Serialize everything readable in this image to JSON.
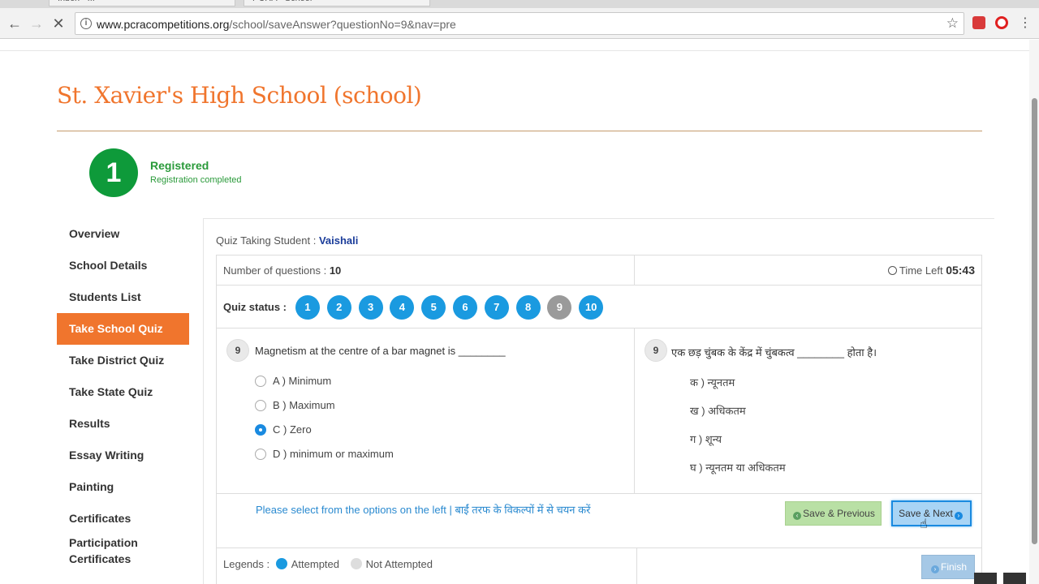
{
  "browser": {
    "tabs": [
      "Inbox - ...",
      "PCRA - School"
    ],
    "url_host": "www.pcracompetitions.org",
    "url_path": "/school/saveAnswer?questionNo=9&nav=pre"
  },
  "page": {
    "school_title": "St. Xavier's High School (school)",
    "step": {
      "number": "1",
      "title": "Registered",
      "subtitle": "Registration completed"
    }
  },
  "sidebar": {
    "items": [
      {
        "label": "Overview"
      },
      {
        "label": "School Details"
      },
      {
        "label": "Students List"
      },
      {
        "label": "Take School Quiz"
      },
      {
        "label": "Take District Quiz"
      },
      {
        "label": "Take State Quiz"
      },
      {
        "label": "Results"
      },
      {
        "label": "Essay Writing"
      },
      {
        "label": "Painting"
      },
      {
        "label": "Certificates"
      },
      {
        "label": "Participation Certificates"
      }
    ]
  },
  "quiz": {
    "student_label": "Quiz Taking Student :",
    "student_name": "Vaishali",
    "num_questions_label": "Number of questions :",
    "num_questions": "10",
    "time_left_label": "Time Left",
    "time_left": "05:43",
    "status_label": "Quiz status :",
    "question_numbers": [
      "1",
      "2",
      "3",
      "4",
      "5",
      "6",
      "7",
      "8",
      "9",
      "10"
    ],
    "current_question": "9",
    "question_en": "Magnetism at the centre of a bar magnet is ________",
    "options_en": [
      "A ) Minimum",
      "B ) Maximum",
      "C ) Zero",
      "D ) minimum or maximum"
    ],
    "selected_option": "C ) Zero",
    "question_hi": "एक छड़ चुंबक के केंद्र में चुंबकत्व ________ होता है।",
    "options_hi": [
      "क ) न्यूनतम",
      "ख ) अधिकतम",
      "ग ) शून्य",
      "घ ) न्यूनतम या अधिकतम"
    ],
    "note": "Please select from the options on the left | बाईं तरफ के विकल्पों में से चयन करें",
    "save_prev_label": "Save & Previous",
    "save_next_label": "Save & Next",
    "legends_label": "Legends :",
    "legend_attempted": "Attempted",
    "legend_not_attempted": "Not Attempted",
    "finish_label": "Finish"
  },
  "colors": {
    "brand_orange": "#f0752d",
    "attempted_blue": "#1a9ae0",
    "current_gray": "#9a9a9a",
    "registered_green": "#0e9a3a"
  }
}
